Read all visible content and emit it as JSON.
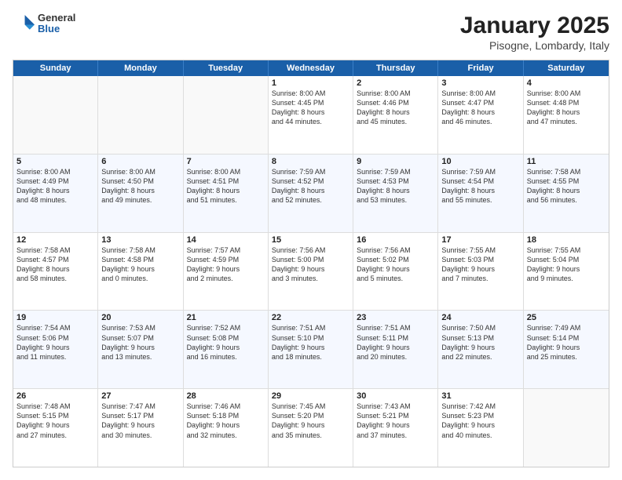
{
  "logo": {
    "general": "General",
    "blue": "Blue"
  },
  "header": {
    "month": "January 2025",
    "location": "Pisogne, Lombardy, Italy"
  },
  "days": [
    "Sunday",
    "Monday",
    "Tuesday",
    "Wednesday",
    "Thursday",
    "Friday",
    "Saturday"
  ],
  "rows": [
    [
      {
        "day": "",
        "info": ""
      },
      {
        "day": "",
        "info": ""
      },
      {
        "day": "",
        "info": ""
      },
      {
        "day": "1",
        "info": "Sunrise: 8:00 AM\nSunset: 4:45 PM\nDaylight: 8 hours\nand 44 minutes."
      },
      {
        "day": "2",
        "info": "Sunrise: 8:00 AM\nSunset: 4:46 PM\nDaylight: 8 hours\nand 45 minutes."
      },
      {
        "day": "3",
        "info": "Sunrise: 8:00 AM\nSunset: 4:47 PM\nDaylight: 8 hours\nand 46 minutes."
      },
      {
        "day": "4",
        "info": "Sunrise: 8:00 AM\nSunset: 4:48 PM\nDaylight: 8 hours\nand 47 minutes."
      }
    ],
    [
      {
        "day": "5",
        "info": "Sunrise: 8:00 AM\nSunset: 4:49 PM\nDaylight: 8 hours\nand 48 minutes."
      },
      {
        "day": "6",
        "info": "Sunrise: 8:00 AM\nSunset: 4:50 PM\nDaylight: 8 hours\nand 49 minutes."
      },
      {
        "day": "7",
        "info": "Sunrise: 8:00 AM\nSunset: 4:51 PM\nDaylight: 8 hours\nand 51 minutes."
      },
      {
        "day": "8",
        "info": "Sunrise: 7:59 AM\nSunset: 4:52 PM\nDaylight: 8 hours\nand 52 minutes."
      },
      {
        "day": "9",
        "info": "Sunrise: 7:59 AM\nSunset: 4:53 PM\nDaylight: 8 hours\nand 53 minutes."
      },
      {
        "day": "10",
        "info": "Sunrise: 7:59 AM\nSunset: 4:54 PM\nDaylight: 8 hours\nand 55 minutes."
      },
      {
        "day": "11",
        "info": "Sunrise: 7:58 AM\nSunset: 4:55 PM\nDaylight: 8 hours\nand 56 minutes."
      }
    ],
    [
      {
        "day": "12",
        "info": "Sunrise: 7:58 AM\nSunset: 4:57 PM\nDaylight: 8 hours\nand 58 minutes."
      },
      {
        "day": "13",
        "info": "Sunrise: 7:58 AM\nSunset: 4:58 PM\nDaylight: 9 hours\nand 0 minutes."
      },
      {
        "day": "14",
        "info": "Sunrise: 7:57 AM\nSunset: 4:59 PM\nDaylight: 9 hours\nand 2 minutes."
      },
      {
        "day": "15",
        "info": "Sunrise: 7:56 AM\nSunset: 5:00 PM\nDaylight: 9 hours\nand 3 minutes."
      },
      {
        "day": "16",
        "info": "Sunrise: 7:56 AM\nSunset: 5:02 PM\nDaylight: 9 hours\nand 5 minutes."
      },
      {
        "day": "17",
        "info": "Sunrise: 7:55 AM\nSunset: 5:03 PM\nDaylight: 9 hours\nand 7 minutes."
      },
      {
        "day": "18",
        "info": "Sunrise: 7:55 AM\nSunset: 5:04 PM\nDaylight: 9 hours\nand 9 minutes."
      }
    ],
    [
      {
        "day": "19",
        "info": "Sunrise: 7:54 AM\nSunset: 5:06 PM\nDaylight: 9 hours\nand 11 minutes."
      },
      {
        "day": "20",
        "info": "Sunrise: 7:53 AM\nSunset: 5:07 PM\nDaylight: 9 hours\nand 13 minutes."
      },
      {
        "day": "21",
        "info": "Sunrise: 7:52 AM\nSunset: 5:08 PM\nDaylight: 9 hours\nand 16 minutes."
      },
      {
        "day": "22",
        "info": "Sunrise: 7:51 AM\nSunset: 5:10 PM\nDaylight: 9 hours\nand 18 minutes."
      },
      {
        "day": "23",
        "info": "Sunrise: 7:51 AM\nSunset: 5:11 PM\nDaylight: 9 hours\nand 20 minutes."
      },
      {
        "day": "24",
        "info": "Sunrise: 7:50 AM\nSunset: 5:13 PM\nDaylight: 9 hours\nand 22 minutes."
      },
      {
        "day": "25",
        "info": "Sunrise: 7:49 AM\nSunset: 5:14 PM\nDaylight: 9 hours\nand 25 minutes."
      }
    ],
    [
      {
        "day": "26",
        "info": "Sunrise: 7:48 AM\nSunset: 5:15 PM\nDaylight: 9 hours\nand 27 minutes."
      },
      {
        "day": "27",
        "info": "Sunrise: 7:47 AM\nSunset: 5:17 PM\nDaylight: 9 hours\nand 30 minutes."
      },
      {
        "day": "28",
        "info": "Sunrise: 7:46 AM\nSunset: 5:18 PM\nDaylight: 9 hours\nand 32 minutes."
      },
      {
        "day": "29",
        "info": "Sunrise: 7:45 AM\nSunset: 5:20 PM\nDaylight: 9 hours\nand 35 minutes."
      },
      {
        "day": "30",
        "info": "Sunrise: 7:43 AM\nSunset: 5:21 PM\nDaylight: 9 hours\nand 37 minutes."
      },
      {
        "day": "31",
        "info": "Sunrise: 7:42 AM\nSunset: 5:23 PM\nDaylight: 9 hours\nand 40 minutes."
      },
      {
        "day": "",
        "info": ""
      }
    ]
  ]
}
